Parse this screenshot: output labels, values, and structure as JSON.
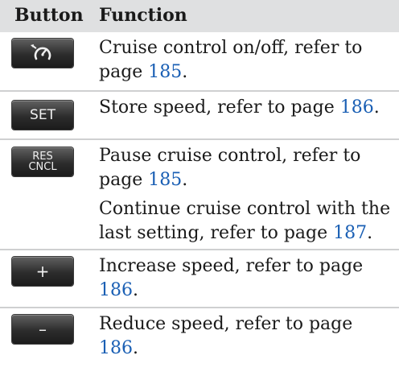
{
  "header": {
    "col_button": "Button",
    "col_function": "Function"
  },
  "rows": [
    {
      "button": {
        "icon": "cruise-control-icon",
        "label": ""
      },
      "paragraphs": [
        {
          "text": "Cruise control on/off, refer to page ",
          "page": "185",
          "end": "."
        }
      ]
    },
    {
      "button": {
        "label": "SET"
      },
      "paragraphs": [
        {
          "text": "Store speed, refer to page ",
          "page": "186",
          "end": "."
        }
      ]
    },
    {
      "button": {
        "label": "RES\nCNCL"
      },
      "paragraphs": [
        {
          "text": "Pause cruise control, refer to page ",
          "page": "185",
          "end": "."
        },
        {
          "text": "Continue cruise control with the last setting, refer to page ",
          "page": "187",
          "end": "."
        }
      ]
    },
    {
      "button": {
        "label": "+"
      },
      "paragraphs": [
        {
          "text": "Increase speed, refer to page ",
          "page": "186",
          "end": "."
        }
      ]
    },
    {
      "button": {
        "label": "–"
      },
      "paragraphs": [
        {
          "text": "Reduce speed, refer to page ",
          "page": "186",
          "end": "."
        }
      ]
    }
  ],
  "colors": {
    "header_bg": "#dfe0e1",
    "link": "#1a5fb4",
    "button": "#2c2c2c"
  }
}
